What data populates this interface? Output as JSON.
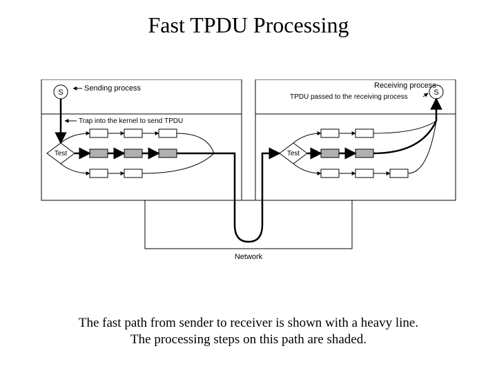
{
  "title": "Fast TPDU Processing",
  "caption_line1": "The fast path from sender to receiver is shown with a heavy line.",
  "caption_line2": "The processing steps on this path are shaded.",
  "diagram": {
    "sender": {
      "s_label": "S",
      "sending_process": "Sending process",
      "trap": "Trap into the kernel to send TPDU",
      "test": "Test"
    },
    "receiver": {
      "s_label": "S",
      "receiving_process": "Receiving process",
      "passed": "TPDU passed to the receiving process",
      "test": "Test"
    },
    "network": "Network"
  }
}
